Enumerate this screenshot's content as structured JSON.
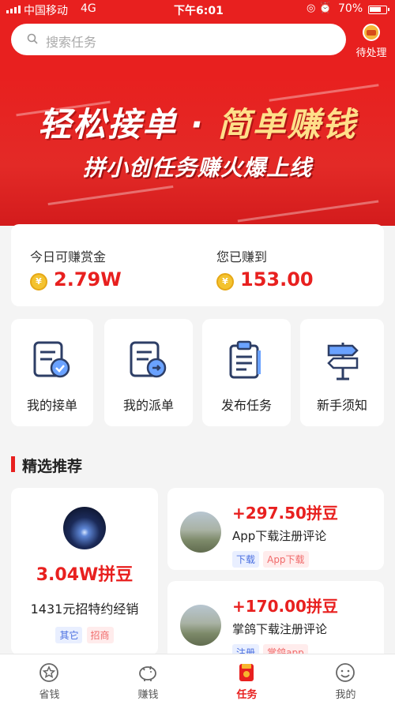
{
  "status_bar": {
    "carrier": "中国移动",
    "network": "4G",
    "time": "下午6:01",
    "battery": "70%"
  },
  "header": {
    "search_placeholder": "搜索任务",
    "pending_label": "待处理"
  },
  "banner": {
    "headline_left": "轻松接单",
    "headline_dot": "·",
    "headline_right": "简单赚钱",
    "subline": "拼小创任务赚火爆上线"
  },
  "earnings": {
    "today_label": "今日可赚赏金",
    "today_value": "2.79W",
    "earned_label": "您已赚到",
    "earned_value": "153.00",
    "coin_symbol": "¥"
  },
  "shortcuts": [
    {
      "label": "我的接单",
      "icon": "order-check-icon"
    },
    {
      "label": "我的派单",
      "icon": "order-send-icon"
    },
    {
      "label": "发布任务",
      "icon": "clipboard-icon"
    },
    {
      "label": "新手须知",
      "icon": "signpost-icon"
    }
  ],
  "featured": {
    "title": "精选推荐",
    "main_card": {
      "price": "3.04W拼豆",
      "name": "1431元招特约经销",
      "tags": [
        "其它",
        "招商"
      ]
    },
    "tasks": [
      {
        "price": "+297.50拼豆",
        "name": "App下载注册评论",
        "tags": [
          "下载",
          "App下载"
        ]
      },
      {
        "price": "+170.00拼豆",
        "name": "掌鸽下载注册评论",
        "tags": [
          "注册",
          "掌鸽app"
        ]
      }
    ]
  },
  "tab_bar": {
    "tabs": [
      {
        "label": "省钱",
        "icon": "save-money-icon",
        "active": false
      },
      {
        "label": "赚钱",
        "icon": "piggy-bank-icon",
        "active": false
      },
      {
        "label": "任务",
        "icon": "task-icon",
        "active": true
      },
      {
        "label": "我的",
        "icon": "profile-smile-icon",
        "active": false
      }
    ]
  },
  "colors": {
    "brand_red": "#e8201f",
    "tag_blue": "#4a6fe0",
    "tag_pink": "#f06a6a",
    "coin_gold": "#f4c330"
  }
}
